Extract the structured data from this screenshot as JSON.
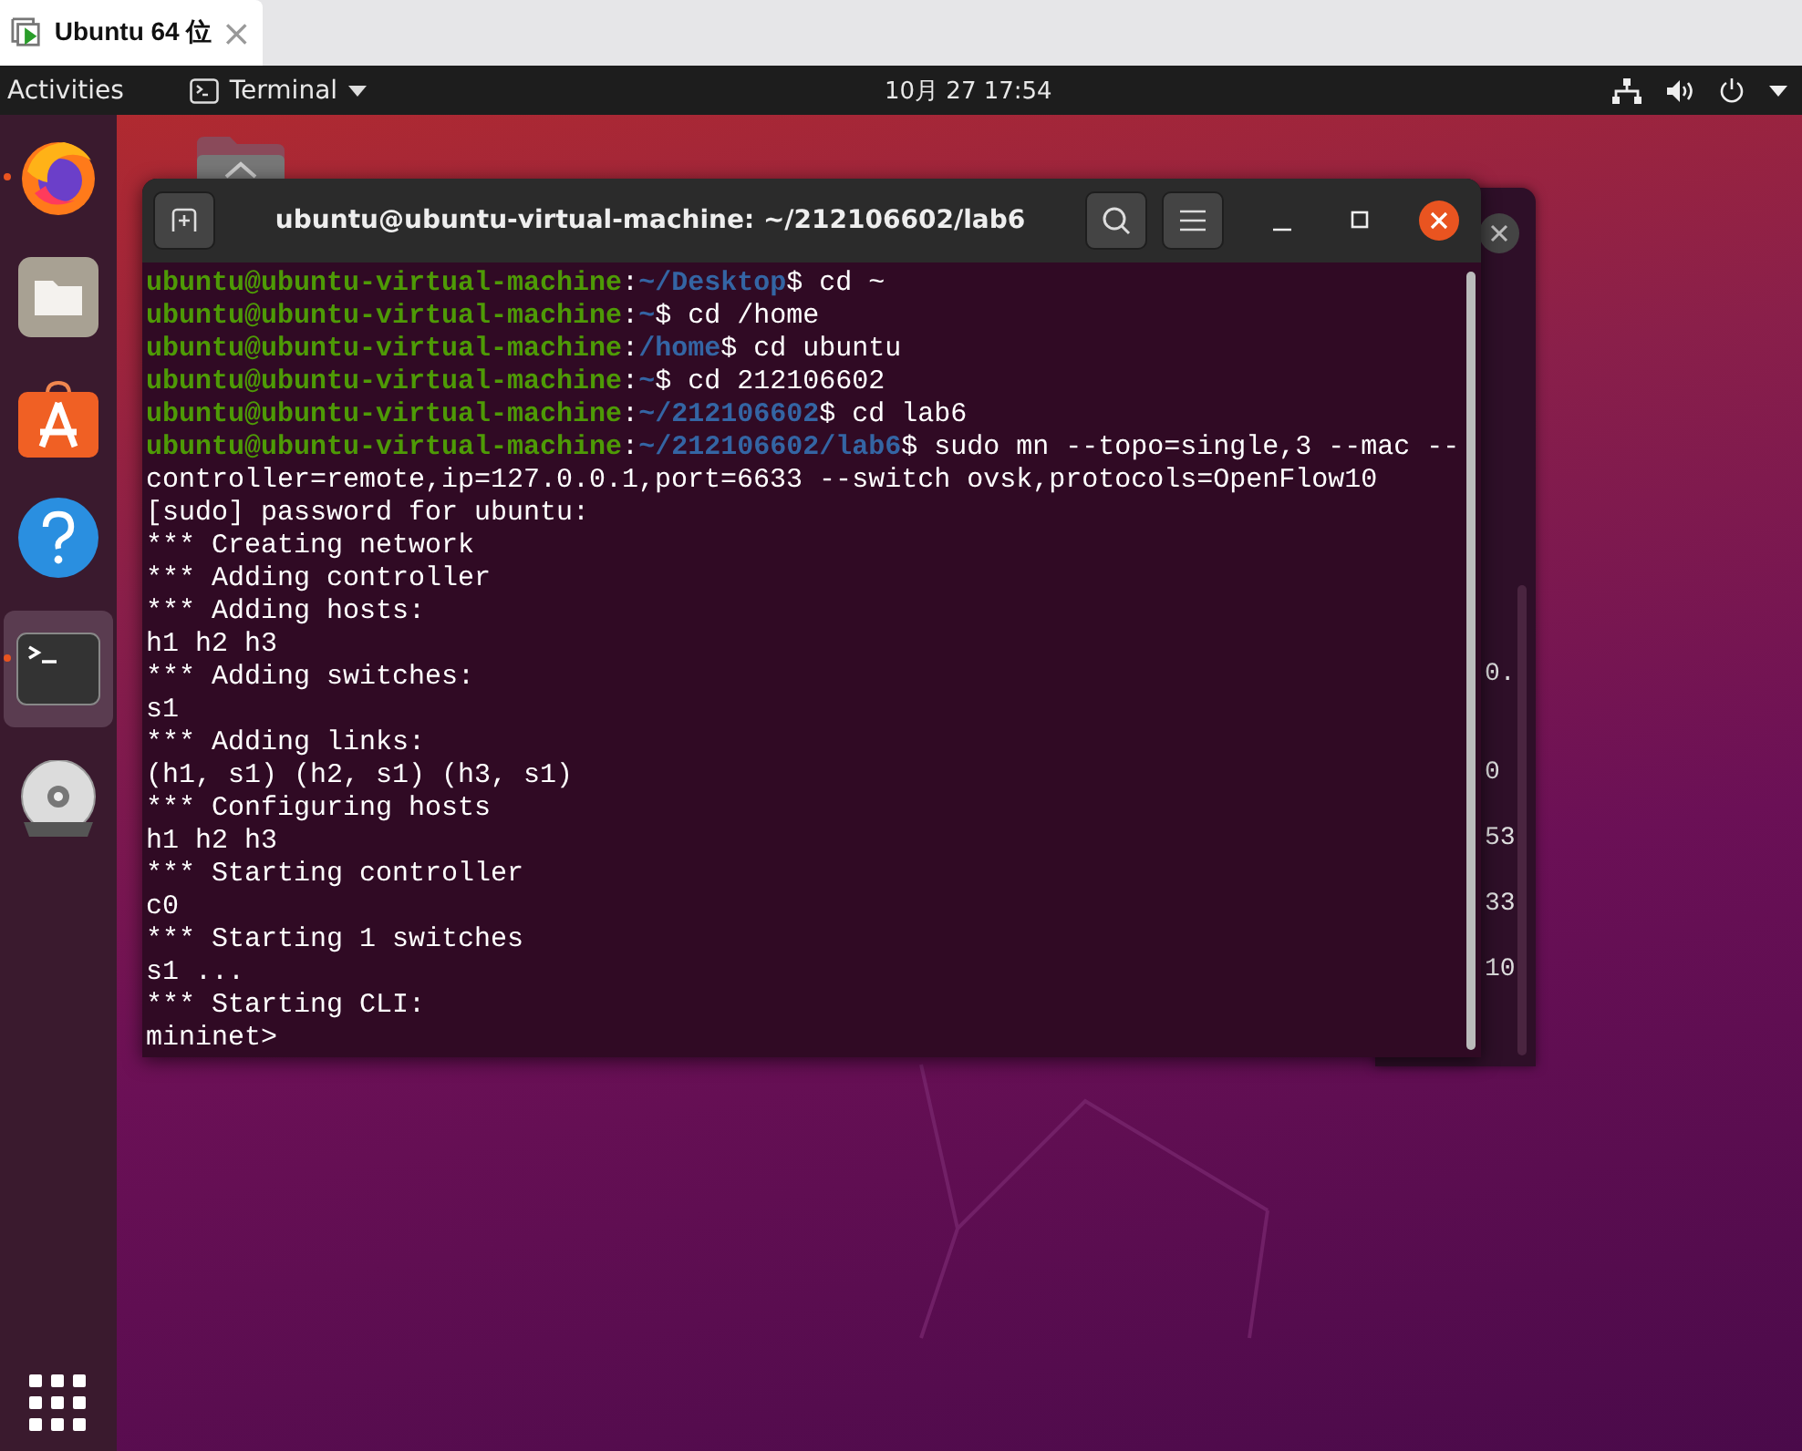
{
  "vm_tab": {
    "title": "Ubuntu 64 位",
    "close": "×"
  },
  "top_bar": {
    "activities": "Activities",
    "app_menu": "Terminal",
    "clock": "10月 27  17:54"
  },
  "dock": [
    {
      "kind": "firefox",
      "running": true,
      "selected": false
    },
    {
      "kind": "files",
      "running": false,
      "selected": false
    },
    {
      "kind": "store",
      "running": false,
      "selected": false
    },
    {
      "kind": "help",
      "running": false,
      "selected": false
    },
    {
      "kind": "terminal",
      "running": true,
      "selected": true
    },
    {
      "kind": "dvd",
      "running": false,
      "selected": false
    }
  ],
  "background_window": {
    "fragments": [
      "0.",
      "0",
      "53",
      "33",
      "10"
    ]
  },
  "terminal": {
    "title": "ubuntu@ubuntu-virtual-machine: ~/212106602/lab6",
    "lines": [
      {
        "kind": "prompt",
        "user": "ubuntu@ubuntu-virtual-machine",
        "separator": ":",
        "path": "~/Desktop",
        "command": "$ cd ~"
      },
      {
        "kind": "prompt",
        "user": "ubuntu@ubuntu-virtual-machine",
        "separator": ":",
        "path": "~",
        "command": "$ cd /home"
      },
      {
        "kind": "prompt",
        "user": "ubuntu@ubuntu-virtual-machine",
        "separator": ":",
        "path": "/home",
        "command": "$ cd ubuntu"
      },
      {
        "kind": "prompt",
        "user": "ubuntu@ubuntu-virtual-machine",
        "separator": ":",
        "path": "~",
        "command": "$ cd 212106602"
      },
      {
        "kind": "prompt",
        "user": "ubuntu@ubuntu-virtual-machine",
        "separator": ":",
        "path": "~/212106602",
        "command": "$ cd lab6"
      },
      {
        "kind": "prompt",
        "user": "ubuntu@ubuntu-virtual-machine",
        "separator": ":",
        "path": "~/212106602/lab6",
        "command": "$ sudo mn --topo=single,3 --mac --"
      },
      {
        "kind": "output",
        "text": "controller=remote,ip=127.0.0.1,port=6633 --switch ovsk,protocols=OpenFlow10"
      },
      {
        "kind": "output",
        "text": "[sudo] password for ubuntu:"
      },
      {
        "kind": "output",
        "text": "*** Creating network"
      },
      {
        "kind": "output",
        "text": "*** Adding controller"
      },
      {
        "kind": "output",
        "text": "*** Adding hosts:"
      },
      {
        "kind": "output",
        "text": "h1 h2 h3"
      },
      {
        "kind": "output",
        "text": "*** Adding switches:"
      },
      {
        "kind": "output",
        "text": "s1"
      },
      {
        "kind": "output",
        "text": "*** Adding links:"
      },
      {
        "kind": "output",
        "text": "(h1, s1) (h2, s1) (h3, s1)"
      },
      {
        "kind": "output",
        "text": "*** Configuring hosts"
      },
      {
        "kind": "output",
        "text": "h1 h2 h3"
      },
      {
        "kind": "output",
        "text": "*** Starting controller"
      },
      {
        "kind": "output",
        "text": "c0"
      },
      {
        "kind": "output",
        "text": "*** Starting 1 switches"
      },
      {
        "kind": "output",
        "text": "s1 ..."
      },
      {
        "kind": "output",
        "text": "*** Starting CLI:"
      },
      {
        "kind": "output",
        "text": "mininet>"
      }
    ]
  }
}
